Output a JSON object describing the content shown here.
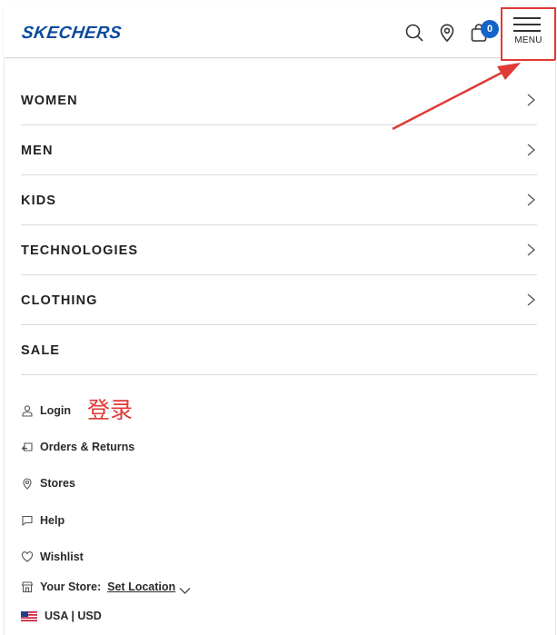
{
  "header": {
    "logo_text": "SKECHERS",
    "search_icon": "search-icon",
    "store_icon": "location-pin-icon",
    "bag_icon": "shopping-bag-icon",
    "bag_count": "0",
    "menu_label": "MENU",
    "brand_color": "#0a4a9e",
    "badge_color": "#1464c8"
  },
  "nav": {
    "items": [
      {
        "label": "WOMEN",
        "has_chevron": true
      },
      {
        "label": "MEN",
        "has_chevron": true
      },
      {
        "label": "KIDS",
        "has_chevron": true
      },
      {
        "label": "TECHNOLOGIES",
        "has_chevron": true
      },
      {
        "label": "CLOTHING",
        "has_chevron": true
      },
      {
        "label": "SALE",
        "has_chevron": false
      }
    ]
  },
  "utility": {
    "login": "Login",
    "orders": "Orders & Returns",
    "stores": "Stores",
    "help": "Help",
    "wishlist": "Wishlist",
    "your_store": "Your Store:",
    "set_location": "Set Location",
    "locale": "USA | USD"
  },
  "annotation": {
    "text": "登录",
    "color": "#e03a36"
  }
}
